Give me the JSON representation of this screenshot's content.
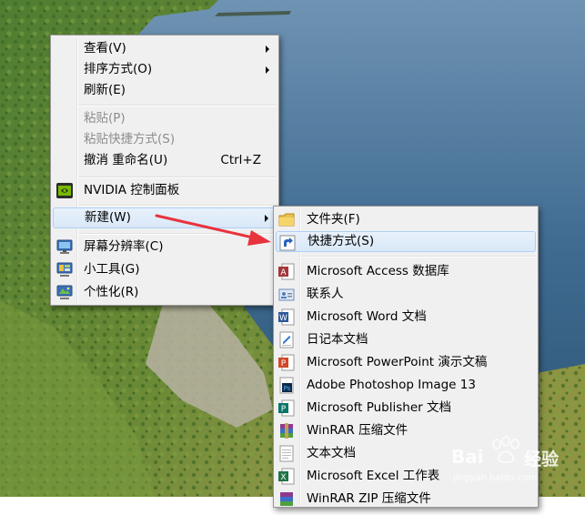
{
  "context_menu": {
    "items": [
      {
        "label": "查看(V)"
      },
      {
        "label": "排序方式(O)"
      },
      {
        "label": "刷新(E)"
      },
      {
        "label": "粘贴(P)"
      },
      {
        "label": "粘贴快捷方式(S)"
      },
      {
        "label": "撤消 重命名(U)",
        "shortcut": "Ctrl+Z"
      },
      {
        "label": "NVIDIA 控制面板"
      },
      {
        "label": "新建(W)"
      },
      {
        "label": "屏幕分辨率(C)"
      },
      {
        "label": "小工具(G)"
      },
      {
        "label": "个性化(R)"
      }
    ]
  },
  "new_submenu": {
    "items": [
      {
        "label": "文件夹(F)"
      },
      {
        "label": "快捷方式(S)"
      },
      {
        "label": "Microsoft Access 数据库"
      },
      {
        "label": "联系人"
      },
      {
        "label": "Microsoft Word 文档"
      },
      {
        "label": "日记本文档"
      },
      {
        "label": "Microsoft PowerPoint 演示文稿"
      },
      {
        "label": "Adobe Photoshop Image 13"
      },
      {
        "label": "Microsoft Publisher 文档"
      },
      {
        "label": "WinRAR 压缩文件"
      },
      {
        "label": "文本文档"
      },
      {
        "label": "Microsoft Excel 工作表"
      },
      {
        "label": "WinRAR ZIP 压缩文件"
      }
    ]
  },
  "watermark": {
    "brand": "Bai",
    "brand2": "经验",
    "url": "jingyan.baidu.com"
  },
  "colors": {
    "annotation_arrow": "#e8323c",
    "hover_bg": "#dce9f8",
    "menu_bg": "#f0f0f0"
  }
}
